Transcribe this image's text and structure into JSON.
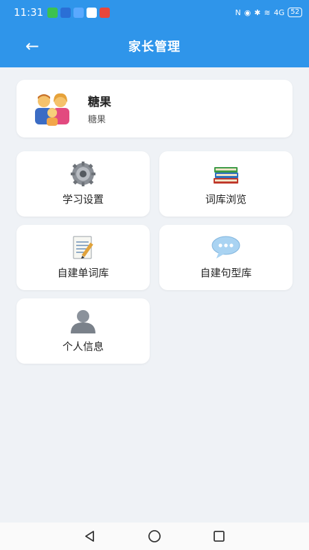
{
  "status_bar": {
    "time": "11:31",
    "battery": "52",
    "signal_label": "4G",
    "app_icons": [
      "wechat-icon",
      "cloud-icon",
      "bluetooth-app-icon",
      "qq-icon",
      "mail-app-icon"
    ]
  },
  "header": {
    "title": "家长管理",
    "back_glyph": "←",
    "bg_color": "#2f95ea"
  },
  "profile": {
    "name": "糖果",
    "subtitle": "糖果"
  },
  "menu": [
    {
      "id": "learning-settings",
      "label": "学习设置",
      "icon": "gear-icon"
    },
    {
      "id": "wordbank-browse",
      "label": "词库浏览",
      "icon": "books-icon"
    },
    {
      "id": "custom-wordbank",
      "label": "自建单词库",
      "icon": "notepad-icon"
    },
    {
      "id": "custom-sentencebank",
      "label": "自建句型库",
      "icon": "speech-bubble-icon"
    },
    {
      "id": "personal-info",
      "label": "个人信息",
      "icon": "person-icon"
    }
  ]
}
